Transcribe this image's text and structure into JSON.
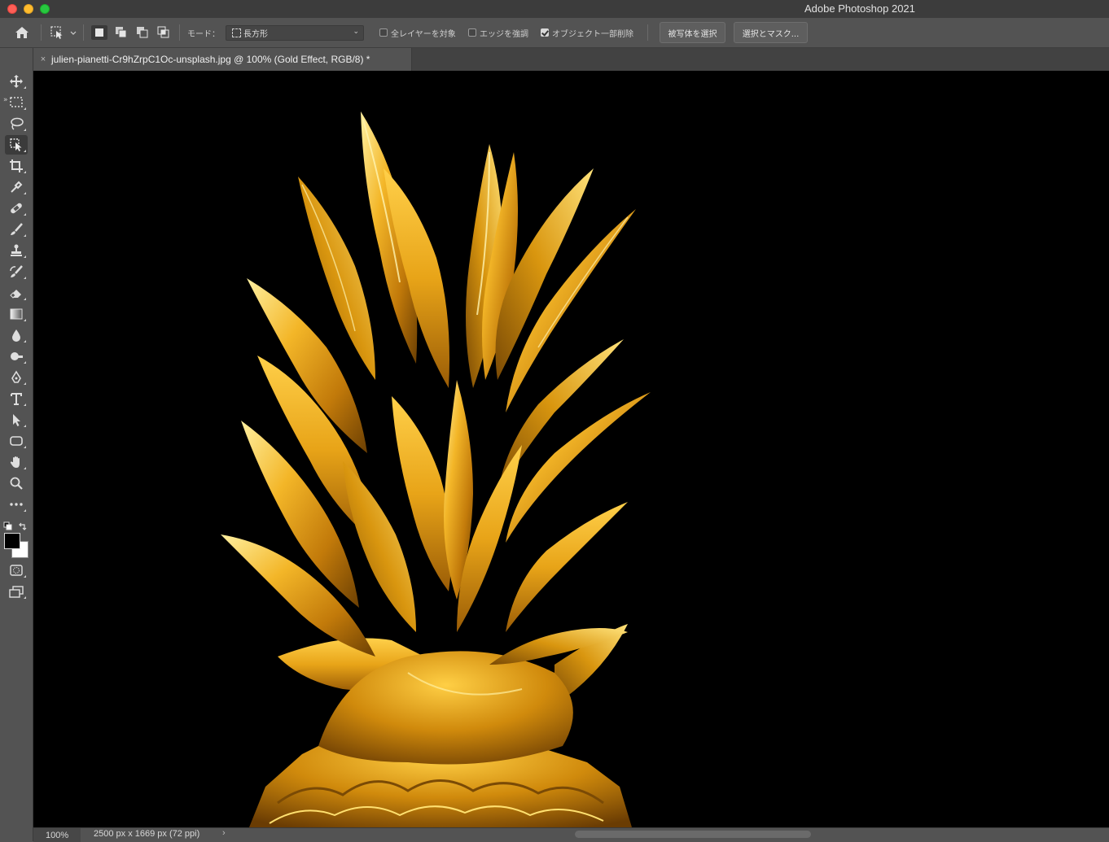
{
  "window": {
    "app_title": "Adobe Photoshop 2021"
  },
  "options_bar": {
    "mode_label": "モード：",
    "mode_value": "長方形",
    "checkbox_all_layers": {
      "label": "全レイヤーを対象",
      "checked": false
    },
    "checkbox_enhance_edge": {
      "label": "エッジを強調",
      "checked": false
    },
    "checkbox_object_subtract": {
      "label": "オブジェクト一部削除",
      "checked": true
    },
    "select_subject_label": "被写体を選択",
    "select_and_mask_label": "選択とマスク..."
  },
  "document": {
    "tab_title": "julien-pianetti-Cr9hZrpC1Oc-unsplash.jpg @ 100% (Gold Effect, RGB/8) *",
    "tab_close_symbol": "×"
  },
  "toolbar": {
    "expand_symbol": "»",
    "tools": [
      "move-tool",
      "marquee-tool",
      "lasso-tool",
      "object-selection-tool",
      "crop-tool",
      "eyedropper-tool",
      "healing-brush-tool",
      "brush-tool",
      "clone-stamp-tool",
      "history-brush-tool",
      "eraser-tool",
      "gradient-tool",
      "blur-tool",
      "dodge-tool",
      "pen-tool",
      "type-tool",
      "path-selection-tool",
      "rectangle-tool",
      "hand-tool",
      "zoom-tool",
      "more-tools"
    ],
    "foreground_color": "#000000",
    "background_color": "#ffffff"
  },
  "status_bar": {
    "zoom": "100%",
    "doc_info": "2500 px x 1669 px (72 ppi)",
    "arrow": "›"
  },
  "colors": {
    "canvas_background": "#000000",
    "gold_light": "#ffd24a",
    "gold_mid": "#e0a01a",
    "gold_dark": "#7a4a05"
  }
}
